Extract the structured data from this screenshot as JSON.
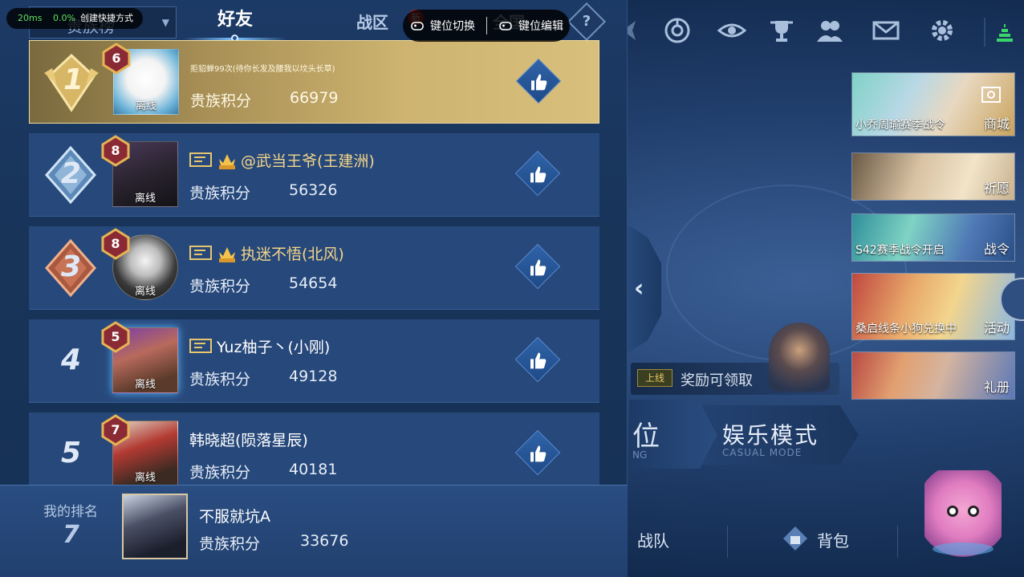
{
  "overlay": {
    "latency": "20ms",
    "loss": "0.0%",
    "shortcut_label": "创建快捷方式",
    "key_switch": "键位切换",
    "key_edit": "键位编辑"
  },
  "tabs": {
    "dropdown": "贵族榜",
    "friends": "好友",
    "zone": "战区",
    "zone_badge": "新",
    "nation": "全国",
    "help": "?"
  },
  "rows": [
    {
      "rank": "1",
      "level": "6",
      "name": "拒貂蝉99次(待你长发及腰我以坟头长草)",
      "status": "离线",
      "label": "贵族积分",
      "score": "66979"
    },
    {
      "rank": "2",
      "level": "8",
      "name": "@武当王爷(王建洲)",
      "status": "离线",
      "label": "贵族积分",
      "score": "56326"
    },
    {
      "rank": "3",
      "level": "8",
      "name": "执迷不悟(北风)",
      "status": "离线",
      "label": "贵族积分",
      "score": "54654"
    },
    {
      "rank": "4",
      "level": "5",
      "name": "Yuz柚子丶(小刚)",
      "status": "离线",
      "label": "贵族积分",
      "score": "49128"
    },
    {
      "rank": "5",
      "level": "7",
      "name": "韩晓超(陨落星辰)",
      "status": "离线",
      "label": "贵族积分",
      "score": "40181"
    }
  ],
  "my_rank": {
    "title": "我的排名",
    "position": "7",
    "name": "不服就坑A",
    "label": "贵族积分",
    "score": "33676"
  },
  "side_cards": [
    {
      "caption": "小乔周瑜赛季战令",
      "label": "商城"
    },
    {
      "caption": "",
      "label": "祈愿"
    },
    {
      "caption": "S42赛季战令开启",
      "label": "战令"
    },
    {
      "caption": "桑启线条小狗兑换中",
      "label": "活动"
    },
    {
      "caption": "",
      "label": "礼册"
    }
  ],
  "reward": {
    "tag": "上线",
    "text": "奖励可领取"
  },
  "modes": {
    "rank_big": "位",
    "rank_en": "NG",
    "casual_big": "娱乐模式",
    "casual_en": "CASUAL MODE"
  },
  "bottom_nav": {
    "team": "战队",
    "bag": "背包"
  },
  "colors": {
    "gold_row": "#cdb36f",
    "row_bg": "#27487a",
    "name_gold": "#f4d58a",
    "ping_green": "#5fe05f"
  }
}
